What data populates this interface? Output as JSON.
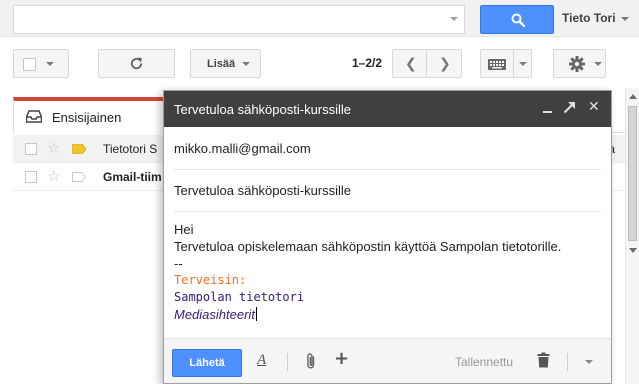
{
  "header": {
    "search_placeholder": "",
    "user_name": "Tieto Tori"
  },
  "toolbar": {
    "more_label": "Lisää",
    "page_count": "1–2/2"
  },
  "inbox": {
    "tab_primary": "Ensisijainen",
    "rows": [
      {
        "sender": "Tietotori S",
        "right_fragment": "ta"
      },
      {
        "sender": "Gmail-tiim",
        "right_fragment": "r"
      }
    ]
  },
  "compose": {
    "title": "Tervetuloa sähköposti-kurssille",
    "to": "mikko.malli@gmail.com",
    "subject": "Tervetuloa sähköposti-kurssille",
    "body": {
      "greeting": "Hei",
      "line": "Tervetuloa opiskelemaan sähköpostin käyttöä Sampolan tietotorille.",
      "sig_sep": "--",
      "regards": "Terveisin:",
      "org": "Sampolan tietotori",
      "dept": "Mediasihteerit"
    },
    "send_label": "Lähetä",
    "saved_label": "Tallennettu"
  },
  "colors": {
    "accent_blue": "#4d90fe",
    "compose_header": "#404040",
    "tab_indicator": "#d14836",
    "regards": "#e8702a",
    "signature": "#351c75"
  },
  "icons": {
    "search": "search-icon",
    "refresh": "refresh-icon",
    "keyboard": "keyboard-icon",
    "settings": "gear-icon",
    "inbox": "inbox-icon",
    "attach": "paperclip-icon",
    "trash": "trash-icon"
  }
}
